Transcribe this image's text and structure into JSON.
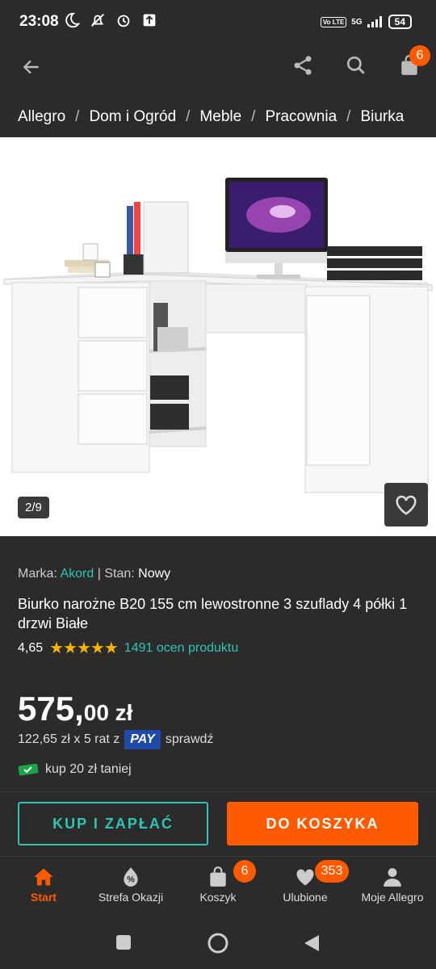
{
  "status": {
    "time": "23:08",
    "network": "5G",
    "volte": "Vo LTE",
    "battery": "54"
  },
  "app_bar": {
    "cart_count": "6"
  },
  "breadcrumb": [
    "Allegro",
    "Dom i Ogród",
    "Meble",
    "Pracownia",
    "Biurka"
  ],
  "gallery": {
    "counter": "2/9"
  },
  "product": {
    "brand_label": "Marka:",
    "brand": "Akord",
    "condition_label": "| Stan:",
    "condition": "Nowy",
    "title": "Biurko narożne B20 155 cm lewostronne 3 szuflady 4 półki 1 drzwi Białe",
    "rating": "4,65",
    "stars": "★★★★★",
    "rating_count": "1491 ocen produktu",
    "price_main": "575,",
    "price_frac": "00 zł",
    "installment": "122,65 zł x 5 rat z",
    "pay_label": "PAY",
    "installment_link": "sprawdź",
    "coupon": "kup 20 zł taniej"
  },
  "actions": {
    "buy_now": "KUP I ZAPŁAĆ",
    "add_to_cart": "DO KOSZYKA"
  },
  "bottom_nav": {
    "start": "Start",
    "deals": "Strefa Okazji",
    "cart": "Koszyk",
    "cart_badge": "6",
    "favorites": "Ulubione",
    "favorites_badge": "353",
    "account": "Moje Allegro"
  },
  "colors": {
    "accent": "#ff5a00",
    "teal": "#2cc5b4",
    "background": "#2b2b2b"
  }
}
